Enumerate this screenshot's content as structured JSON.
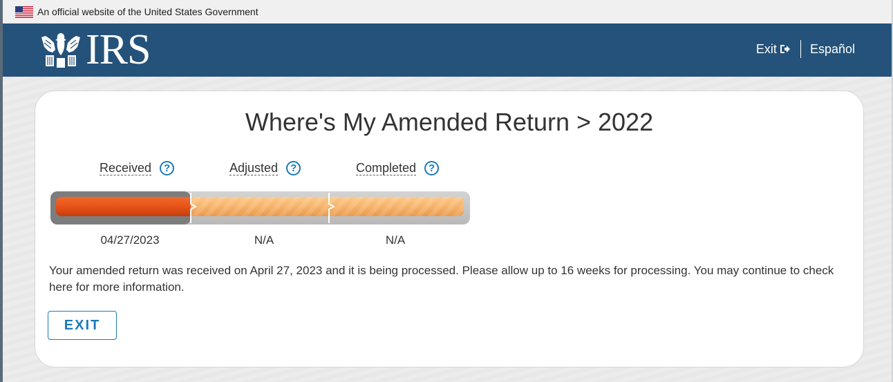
{
  "banner": {
    "text": "An official website of the United States Government"
  },
  "header": {
    "logo_text": "IRS",
    "nav": {
      "exit_label": "Exit",
      "spanish_label": "Español"
    }
  },
  "main": {
    "title": "Where's My Amended Return > 2022",
    "steps": [
      {
        "label": "Received",
        "help": "?",
        "date": "04/27/2023",
        "status": "complete"
      },
      {
        "label": "Adjusted",
        "help": "?",
        "date": "N/A",
        "status": "pending"
      },
      {
        "label": "Completed",
        "help": "?",
        "date": "N/A",
        "status": "pending"
      }
    ],
    "message": "Your amended return was received on April 27, 2023 and it is being processed. Please allow up to 16 weeks for processing. You may continue to check here for more information.",
    "exit_button": "EXIT"
  },
  "colors": {
    "header_bg": "#24527a",
    "accent_blue": "#1b79b8",
    "progress_complete": "#e8531a",
    "progress_pending": "#f7b36a"
  }
}
